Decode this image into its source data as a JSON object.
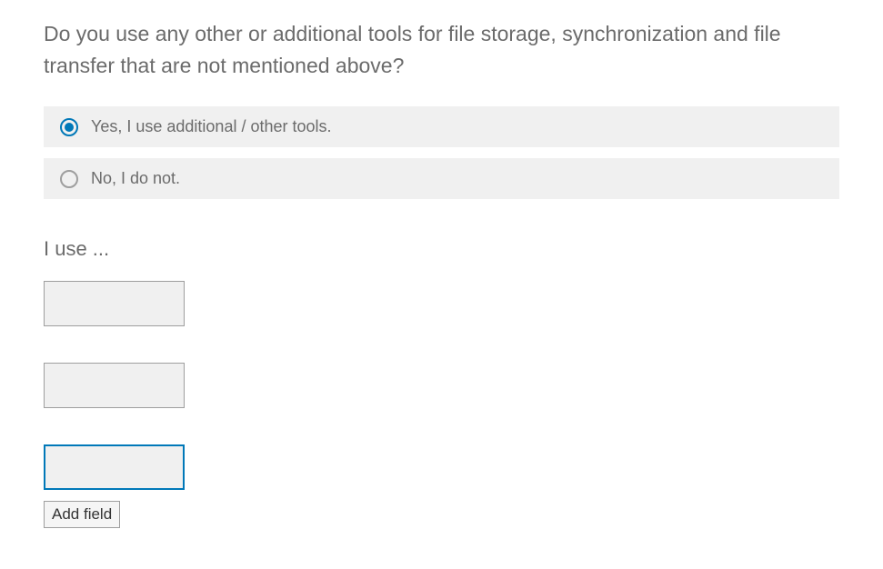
{
  "question": {
    "text": "Do you use any other or additional tools for file storage, synchronization and file transfer that are not mentioned above?"
  },
  "options": [
    {
      "label": "Yes, I use additional / other tools.",
      "selected": true
    },
    {
      "label": "No, I do not.",
      "selected": false
    }
  ],
  "sub_heading": "I use ...",
  "fields": [
    {
      "value": "",
      "focused": false
    },
    {
      "value": "",
      "focused": false
    },
    {
      "value": "",
      "focused": true
    }
  ],
  "add_field_label": "Add field"
}
